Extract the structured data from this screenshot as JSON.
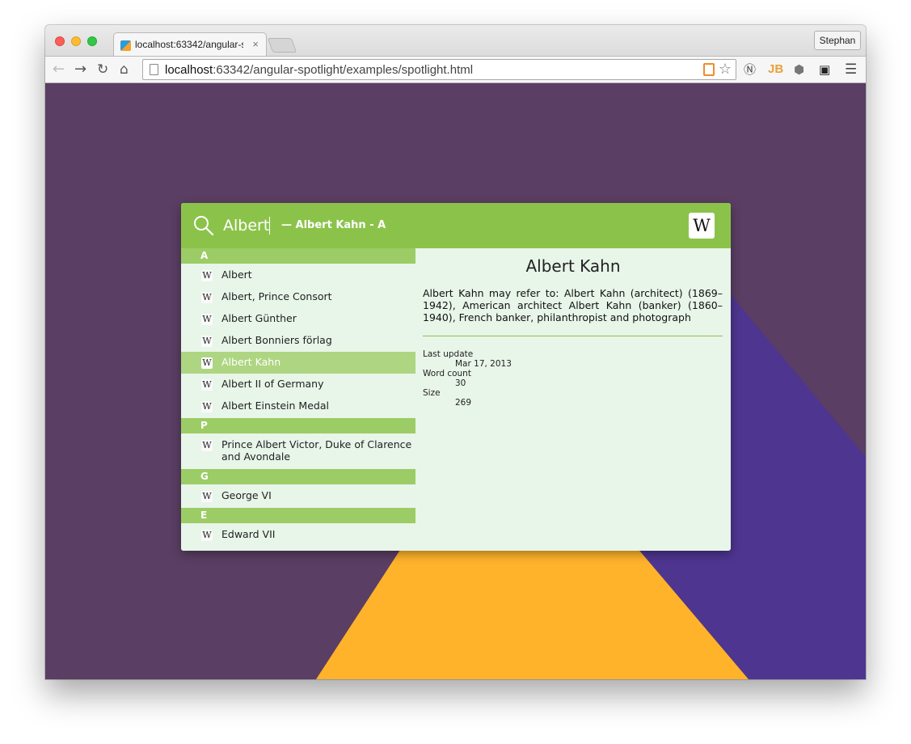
{
  "browser": {
    "tab_title": "localhost:63342/angular-s",
    "tab_close": "×",
    "profile": "Stephan",
    "url_host": "localhost",
    "url_path": ":63342/angular-spotlight/examples/spotlight.html",
    "icons": {
      "back": "back-arrow-icon",
      "forward": "forward-arrow-icon",
      "reload": "reload-icon",
      "home": "home-icon",
      "bookmark": "star-icon",
      "menu": "hamburger-menu-icon"
    }
  },
  "spotlight": {
    "query": "Albert",
    "hint": "— Albert Kahn - A",
    "badge": "W",
    "groups": [
      {
        "header": "A",
        "items": [
          {
            "label": "Albert",
            "icon": "W"
          },
          {
            "label": "Albert, Prince Consort",
            "icon": "W"
          },
          {
            "label": "Albert Günther",
            "icon": "W"
          },
          {
            "label": "Albert Bonniers förlag",
            "icon": "W"
          },
          {
            "label": "Albert Kahn",
            "icon": "W",
            "selected": true
          },
          {
            "label": "Albert II of Germany",
            "icon": "W"
          },
          {
            "label": "Albert Einstein Medal",
            "icon": "W"
          }
        ]
      },
      {
        "header": "P",
        "items": [
          {
            "label": "Prince Albert Victor, Duke of Clarence and Avondale",
            "icon": "W"
          }
        ]
      },
      {
        "header": "G",
        "items": [
          {
            "label": "George VI",
            "icon": "W"
          }
        ]
      },
      {
        "header": "E",
        "items": [
          {
            "label": "Edward VII",
            "icon": "W"
          }
        ]
      }
    ],
    "detail": {
      "title": "Albert Kahn",
      "text": "Albert Kahn may refer to: Albert Kahn (architect) (1869–1942), American architect Albert Kahn (banker) (1860–1940), French banker, philanthropist and photograph",
      "last_update_label": "Last update",
      "last_update": "Mar 17, 2013",
      "word_count_label": "Word count",
      "word_count": "30",
      "size_label": "Size",
      "size": "269"
    }
  },
  "colors": {
    "page_bg": "#5a3e63",
    "accent_green": "#8bc34a",
    "group_green": "#9ccc65",
    "selected_green": "#aed581",
    "panel_bg": "#e8f5e9",
    "shape_indigo": "#4e3590",
    "shape_orange": "#ffb32b"
  }
}
